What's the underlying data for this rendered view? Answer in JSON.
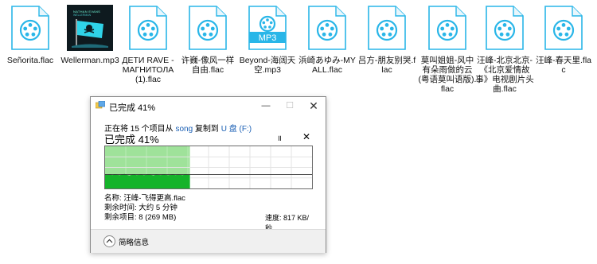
{
  "files": [
    {
      "name": "Señorita.flac",
      "type": "doc"
    },
    {
      "name": "Wellerman.mp3",
      "type": "album"
    },
    {
      "name": "ДЕТИ RAVE - МАГНИТОЛА (1).flac",
      "type": "doc"
    },
    {
      "name": "许巍-像风一样自由.flac",
      "type": "doc"
    },
    {
      "name": "Beyond-海阔天空.mp3",
      "type": "mp3",
      "badge": "MP3"
    },
    {
      "name": "浜崎あゆみ-MY ALL.flac",
      "type": "doc"
    },
    {
      "name": "吕方-朋友别哭.flac",
      "type": "doc"
    },
    {
      "name": "莫叫姐姐-风中有朵雨做的云 (粤语莫叫语版).flac",
      "type": "doc"
    },
    {
      "name": "汪峰-北京北京-《北京爱情故事》电视剧片头曲.flac",
      "type": "doc"
    },
    {
      "name": "汪峰-春天里.flac",
      "type": "doc"
    }
  ],
  "album_art": {
    "caption1": "NATHAN EVANS",
    "caption2": "WELLERMAN"
  },
  "dialog": {
    "title": "已完成 41%",
    "progress_percent": 41,
    "copy_line": {
      "prefix": "正在将 15 个项目从",
      "source": "song",
      "middle": "复制到",
      "dest": "U 盘 (F:)"
    },
    "status": "已完成 41%",
    "pause_symbol": "॥",
    "stop_symbol": "✕",
    "speed_label": "速度: 817 KB/秒",
    "name_line": "名称: 汪峰-飞得更高.flac",
    "time_line": "剩余时间: 大约 5 分钟",
    "items_line": "剩余项目: 8 (269 MB)",
    "footer_label": "简略信息"
  },
  "colors": {
    "accent_blue": "#29b6e8",
    "progress_light": "#9fe29a",
    "progress_dark": "#15b32a"
  },
  "speed_samples": [
    0.72,
    0.7,
    0.74,
    0.69,
    0.73,
    0.71,
    0.68,
    0.72,
    0.75,
    0.7,
    0.66,
    0.71,
    0.73,
    0.69,
    0.7,
    0.72,
    0.68,
    0.71,
    0.74,
    0.7,
    0.67,
    0.72,
    0.7,
    0.69,
    0.73,
    0.71,
    0.68,
    0.7,
    0.72,
    0.69,
    0.71,
    0.7,
    0.68,
    0.72,
    0.71,
    0.7
  ]
}
